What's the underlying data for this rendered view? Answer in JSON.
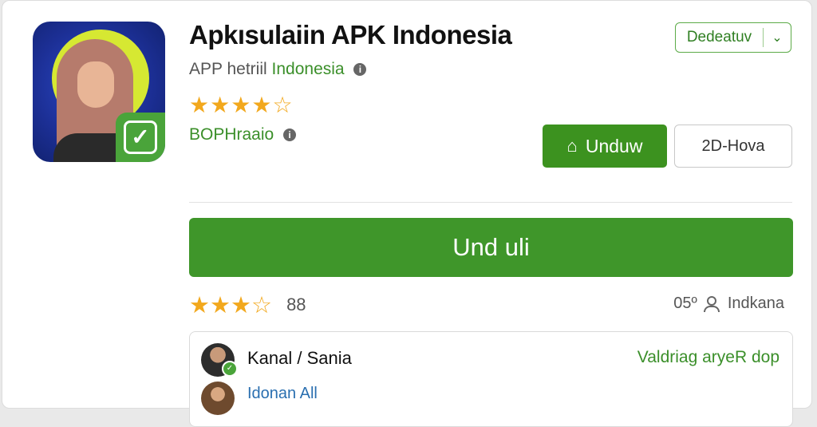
{
  "app": {
    "title": "Apkısulaiin APK Indonesia",
    "subtitle_prefix": "APP hetriil",
    "subtitle_highlight": "Indonesia",
    "developer": "BOPHraaio",
    "rating_stars": 4,
    "rating_max": 5
  },
  "header": {
    "dropdown_label": "Dedeatuv"
  },
  "actions": {
    "primary_label": "Unduw",
    "secondary_label": "2D-Hova",
    "big_button_label": "Und uli"
  },
  "stats": {
    "stars": 3,
    "stars_max": 4,
    "rating_count": "88",
    "right_number": "05º",
    "right_label": "Indkana"
  },
  "reviews": [
    {
      "name": "Kanal / Sania",
      "status": "Valdriag aryeR dop"
    },
    {
      "name": "Idonan All"
    }
  ],
  "colors": {
    "accent_green": "#3c921f",
    "star": "#f2a81d"
  }
}
